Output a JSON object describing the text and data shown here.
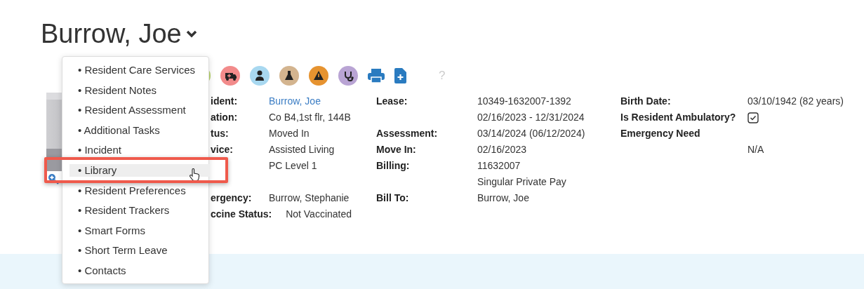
{
  "title": "Burrow, Joe",
  "help_mark": "?",
  "info_rows": [
    {
      "label_a": "ident:",
      "value_a": "Burrow, Joe",
      "value_a_link": true,
      "label_b": "Lease:",
      "value_b": "10349-1632007-1392",
      "label_c": "Birth Date:",
      "value_c": "03/10/1942 (82 years)"
    },
    {
      "label_a": "ation:",
      "value_a": "Co B4,1st flr, 144B",
      "value_b": "02/16/2023 - 12/31/2024",
      "label_c": "Is Resident Ambulatory?",
      "check_c": {
        "checked": true
      }
    },
    {
      "label_a": "tus:",
      "value_a": "Moved In",
      "label_b": "Assessment:",
      "value_b": "03/14/2024 (06/12/2024)",
      "label_c": "Emergency Need"
    },
    {
      "label_a": "vice:",
      "value_a": "Assisted Living",
      "label_b": "Move In:",
      "value_b": "02/16/2023",
      "value_c": "N/A"
    },
    {
      "value_a": "PC Level 1",
      "label_b": "Billing:",
      "value_b": "11632007"
    },
    {
      "value_b": "Singular Private Pay"
    },
    {
      "label_a": "ergency:",
      "value_a": "Burrow, Stephanie",
      "label_b": "Bill To:",
      "value_b": "Burrow, Joe"
    },
    {
      "label_a": "ccine Status:",
      "value_a": "Not Vaccinated"
    }
  ],
  "menu_items": [
    {
      "label": "• Resident Care Services",
      "selected": false
    },
    {
      "label": "• Resident Notes",
      "selected": false
    },
    {
      "label": "• Resident Assessment",
      "selected": false
    },
    {
      "label": "• Additional Tasks",
      "selected": false
    },
    {
      "label": "• Incident",
      "selected": false
    },
    {
      "label": "• Library",
      "selected": true
    },
    {
      "label": "• Resident Preferences",
      "selected": false
    },
    {
      "label": "• Resident Trackers",
      "selected": false
    },
    {
      "label": "• Smart Forms",
      "selected": false
    },
    {
      "label": "• Short Term Leave",
      "selected": false
    },
    {
      "label": "• Contacts",
      "selected": false
    }
  ]
}
